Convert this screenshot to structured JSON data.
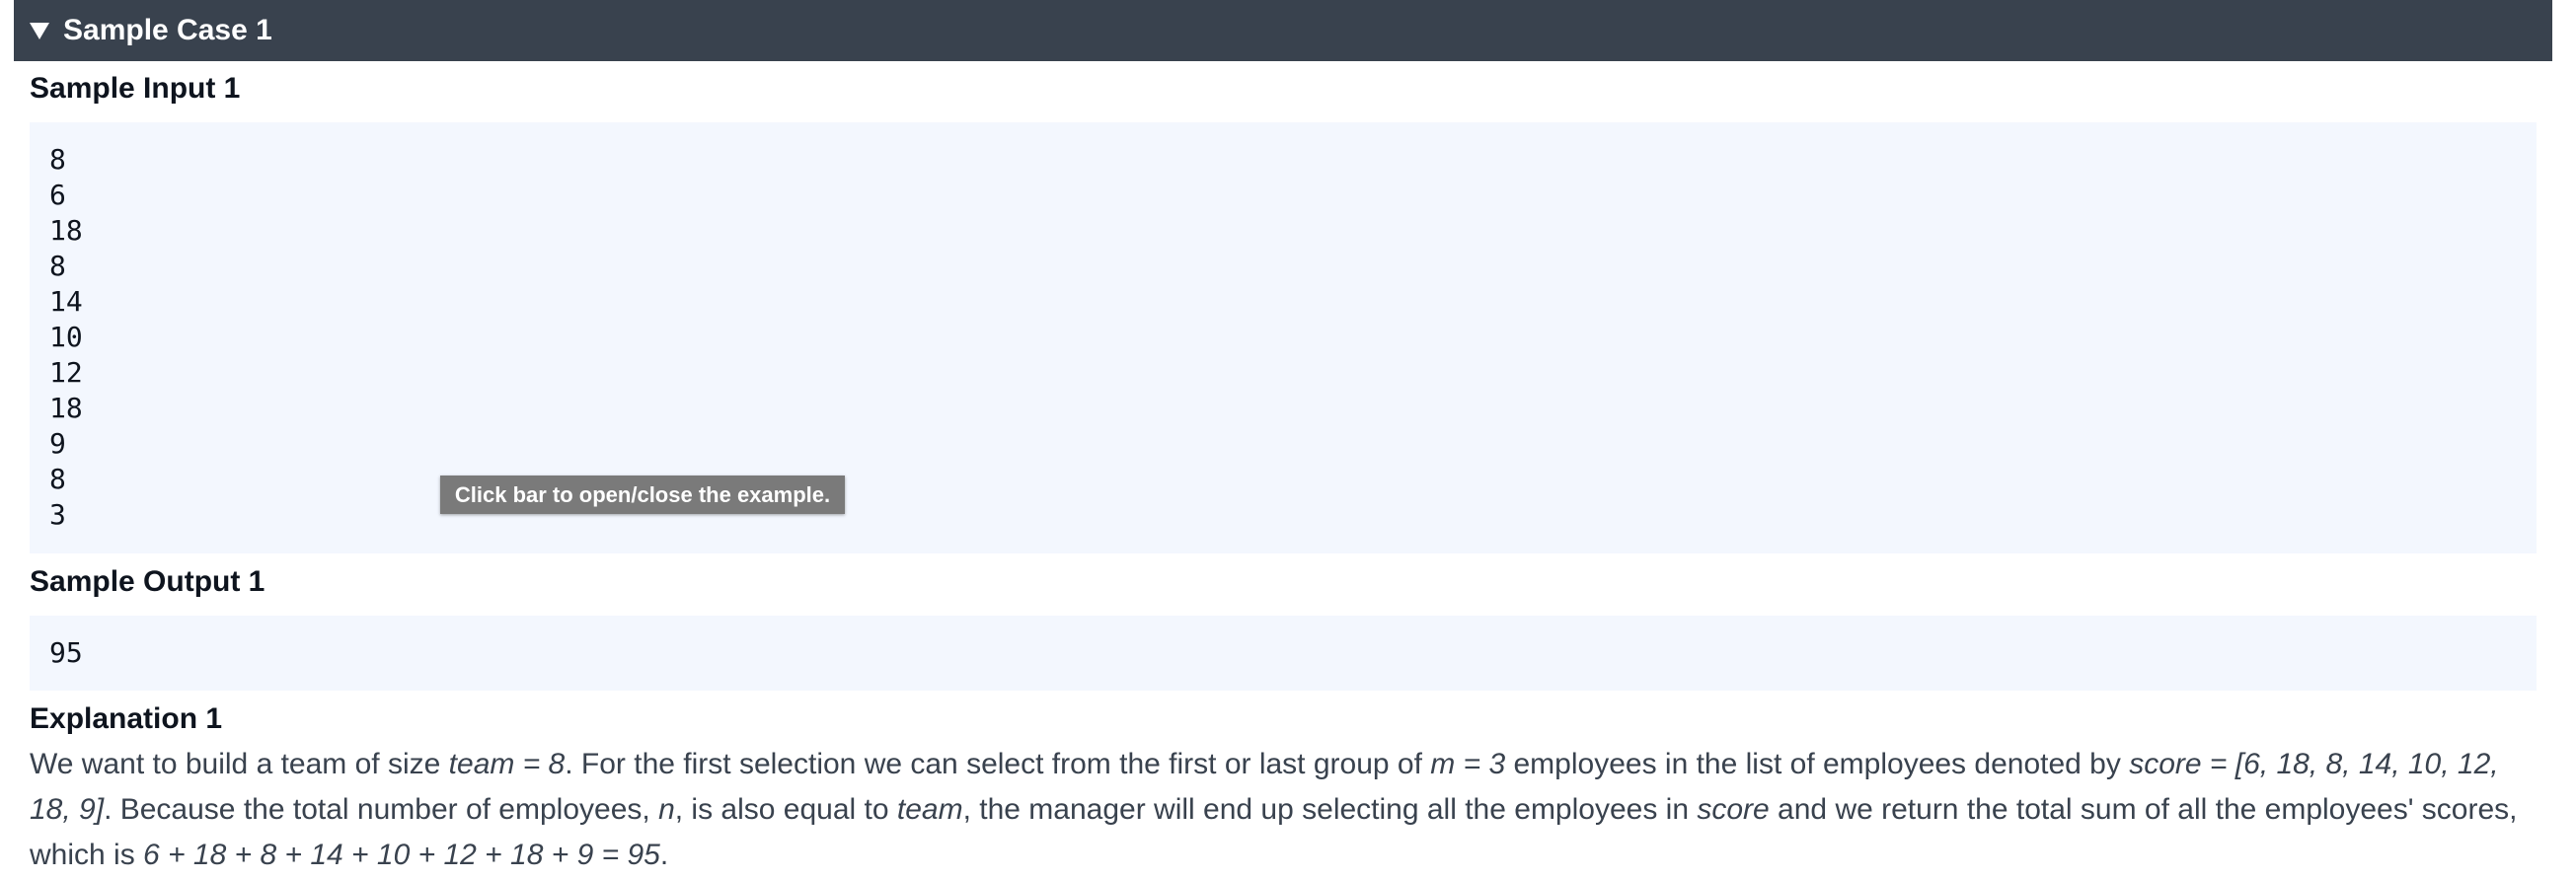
{
  "case_bar": {
    "title": "Sample Case 1"
  },
  "sample_input": {
    "heading": "Sample Input 1",
    "lines": [
      "8",
      "6",
      "18",
      "8",
      "14",
      "10",
      "12",
      "18",
      "9",
      "8",
      "3"
    ]
  },
  "tooltip": {
    "text": "Click bar to open/close the example."
  },
  "sample_output": {
    "heading": "Sample Output 1",
    "value": "95"
  },
  "explanation": {
    "heading": "Explanation 1",
    "p1": "We want to build a team of size ",
    "e1": "team = 8",
    "p2": ". For the first selection we can select from the first or last group of ",
    "e2": "m = 3",
    "p3": " employees in the list of employees denoted by ",
    "e3": "score = [6, 18, 8, 14, 10, 12, 18, 9]",
    "p4": ". Because the total number of employees, ",
    "e4": "n",
    "p5": ", is also equal to ",
    "e5": "team",
    "p6": ", the manager will end up selecting all the employees in ",
    "e6": "score",
    "p7": " and we return the total sum of all the employees' scores, which is ",
    "e7": "6 + 18 + 8 + 14 + 10 + 12 + 18 + 9 = 95",
    "p8": "."
  }
}
